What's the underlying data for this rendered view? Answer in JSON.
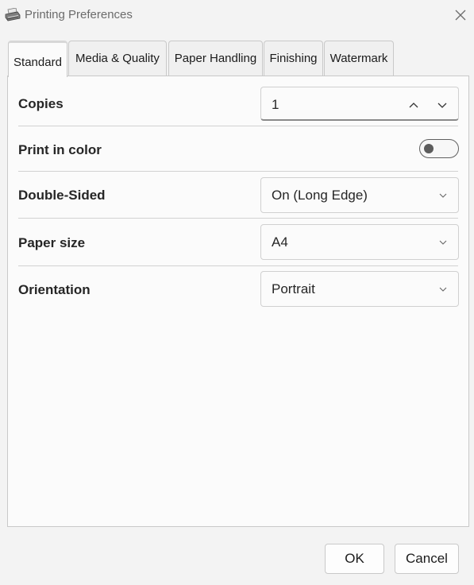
{
  "window": {
    "title": "Printing Preferences",
    "icon": "printer-icon",
    "close_icon": "close-icon"
  },
  "tabs": [
    {
      "label": "Standard",
      "active": true
    },
    {
      "label": "Media & Quality",
      "active": false
    },
    {
      "label": "Paper Handling",
      "active": false
    },
    {
      "label": "Finishing",
      "active": false
    },
    {
      "label": "Watermark",
      "active": false
    }
  ],
  "settings": {
    "copies": {
      "label": "Copies",
      "value": "1"
    },
    "color": {
      "label": "Print in color",
      "on": false
    },
    "duplex": {
      "label": "Double-Sided",
      "value": "On (Long Edge)"
    },
    "paper": {
      "label": "Paper size",
      "value": "A4"
    },
    "orientation": {
      "label": "Orientation",
      "value": "Portrait"
    }
  },
  "buttons": {
    "ok": "OK",
    "cancel": "Cancel"
  },
  "colors": {
    "background": "#f3f3f3",
    "panel": "#fbfbfb",
    "border": "#c9c9c9",
    "text": "#1b1b1b"
  }
}
